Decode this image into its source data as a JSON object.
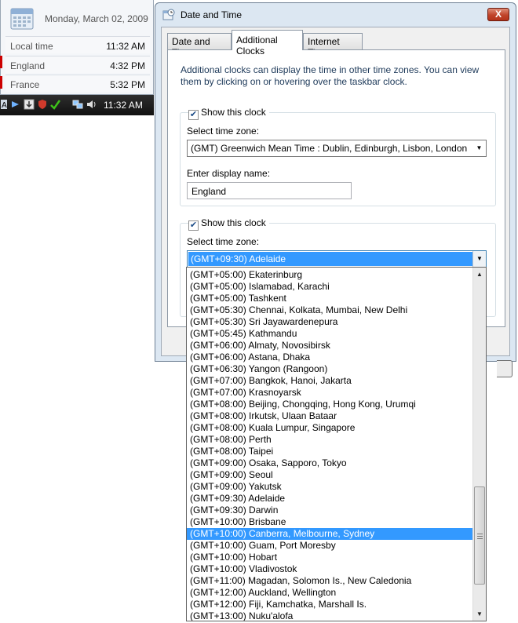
{
  "flyout": {
    "date": "Monday, March 02, 2009",
    "clocks": [
      {
        "name": "Local time",
        "time": "11:32 AM"
      },
      {
        "name": "England",
        "time": "4:32 PM"
      },
      {
        "name": "France",
        "time": "5:32 PM"
      }
    ]
  },
  "taskbar": {
    "time": "11:32 AM"
  },
  "dialog": {
    "title": "Date and Time",
    "close_label": "X",
    "tabs": [
      {
        "label": "Date and Time",
        "active": false
      },
      {
        "label": "Additional Clocks",
        "active": true
      },
      {
        "label": "Internet Time",
        "active": false
      }
    ],
    "intro": "Additional clocks can display the time in other time zones. You can view them by clicking on or hovering over the taskbar clock.",
    "clock1": {
      "show_label": "Show this clock",
      "checked": true,
      "zone_label": "Select time zone:",
      "zone_value": "(GMT) Greenwich Mean Time : Dublin, Edinburgh, Lisbon, London",
      "name_label": "Enter display name:",
      "name_value": "England"
    },
    "clock2": {
      "show_label": "Show this clock",
      "checked": true,
      "zone_label": "Select time zone:",
      "zone_value": "(GMT+09:30) Adelaide"
    }
  },
  "dropdown": {
    "selected_index": 22,
    "options": [
      "(GMT+05:00) Ekaterinburg",
      "(GMT+05:00) Islamabad, Karachi",
      "(GMT+05:00) Tashkent",
      "(GMT+05:30) Chennai, Kolkata, Mumbai, New Delhi",
      "(GMT+05:30) Sri Jayawardenepura",
      "(GMT+05:45) Kathmandu",
      "(GMT+06:00) Almaty, Novosibirsk",
      "(GMT+06:00) Astana, Dhaka",
      "(GMT+06:30) Yangon (Rangoon)",
      "(GMT+07:00) Bangkok, Hanoi, Jakarta",
      "(GMT+07:00) Krasnoyarsk",
      "(GMT+08:00) Beijing, Chongqing, Hong Kong, Urumqi",
      "(GMT+08:00) Irkutsk, Ulaan Bataar",
      "(GMT+08:00) Kuala Lumpur, Singapore",
      "(GMT+08:00) Perth",
      "(GMT+08:00) Taipei",
      "(GMT+09:00) Osaka, Sapporo, Tokyo",
      "(GMT+09:00) Seoul",
      "(GMT+09:00) Yakutsk",
      "(GMT+09:30) Adelaide",
      "(GMT+09:30) Darwin",
      "(GMT+10:00) Brisbane",
      "(GMT+10:00) Canberra, Melbourne, Sydney",
      "(GMT+10:00) Guam, Port Moresby",
      "(GMT+10:00) Hobart",
      "(GMT+10:00) Vladivostok",
      "(GMT+11:00) Magadan, Solomon Is., New Caledonia",
      "(GMT+12:00) Auckland, Wellington",
      "(GMT+12:00) Fiji, Kamchatka, Marshall Is.",
      "(GMT+13:00) Nuku'alofa"
    ],
    "scroll_position": 0.9,
    "scroll_visible_fraction": 0.3
  }
}
